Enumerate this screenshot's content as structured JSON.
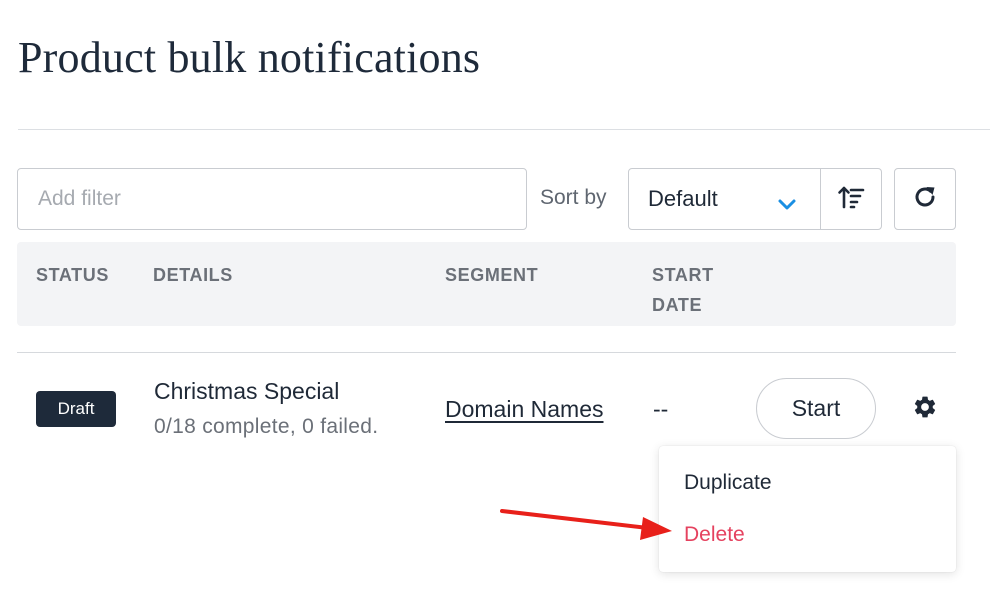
{
  "page": {
    "title": "Product bulk notifications"
  },
  "toolbar": {
    "filter_placeholder": "Add filter",
    "filter_value": "",
    "sort_label": "Sort by",
    "sort_value": "Default",
    "icons": {
      "sort_select": "chevron-down-icon",
      "sort_direction": "sort-ascending-icon",
      "refresh": "refresh-icon"
    },
    "accent_color": "#1a8fe3"
  },
  "table": {
    "columns": [
      "STATUS",
      "DETAILS",
      "SEGMENT",
      "START DATE"
    ],
    "rows": [
      {
        "status": "Draft",
        "name": "Christmas Special",
        "progress": "0/18 complete, 0 failed.",
        "segment": "Domain Names",
        "start_date": "--",
        "action_label": "Start",
        "settings_icon": "gear-icon"
      }
    ]
  },
  "row_menu": {
    "items": [
      {
        "label": "Duplicate",
        "color": "#1f2937"
      },
      {
        "label": "Delete",
        "color": "#e5425f"
      }
    ]
  },
  "annotation": {
    "type": "arrow",
    "color": "#e8201a",
    "points_to": "Delete"
  }
}
